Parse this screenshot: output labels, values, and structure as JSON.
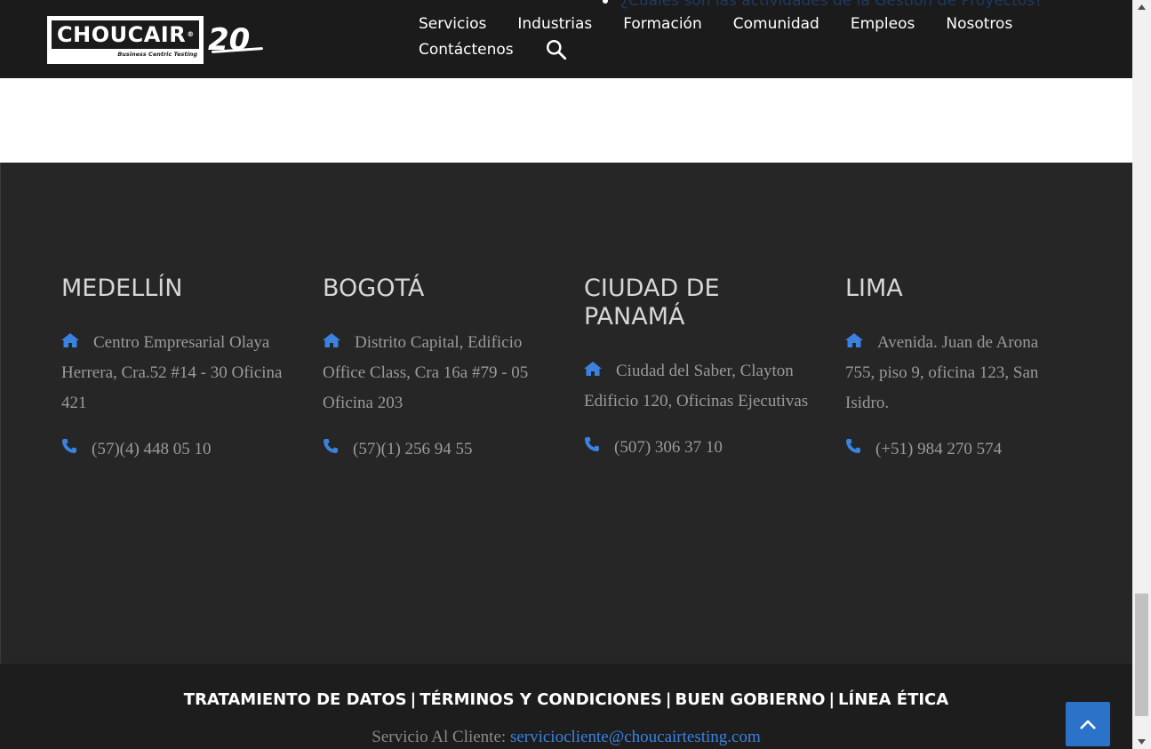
{
  "header": {
    "peek_text": "¿Cuáles son las actividades de la Gestión de Proyectos?",
    "logo": {
      "brand": "CHOUCAIR",
      "tagline": "Business Centric Testing",
      "years": "20"
    },
    "nav": {
      "row1": [
        "Servicios",
        "Industrias",
        "Formación",
        "Comunidad",
        "Empleos",
        "Nosotros"
      ],
      "row2": [
        "Contáctenos"
      ]
    }
  },
  "offices": [
    {
      "city": "MEDELLÍN",
      "address": "Centro Empresarial Olaya Herrera, Cra.52 #14 - 30 Oficina 421",
      "phone": "(57)(4) 448 05 10"
    },
    {
      "city": "BOGOTÁ",
      "address": "Distrito Capital, Edificio Office Class, Cra 16a #79 - 05 Oficina 203",
      "phone": "(57)(1) 256 94 55"
    },
    {
      "city": "CIUDAD DE PANAMÁ",
      "address": "Ciudad del Saber, Clayton Edificio 120, Oficinas Ejecutivas",
      "phone": "(507) 306 37 10"
    },
    {
      "city": "LIMA",
      "address": "Avenida. Juan de Arona 755, piso 9, oficina 123, San Isidro.",
      "phone": "(+51) 984 270 574"
    }
  ],
  "bottom": {
    "links": [
      "TRATAMIENTO DE DATOS",
      "TÉRMINOS Y CONDICIONES",
      "BUEN GOBIERNO",
      "LÍNEA ÉTICA"
    ],
    "separator": "|",
    "service_label": "Servicio Al Cliente:",
    "service_email": "serviciocliente@choucairtesting.com"
  },
  "colors": {
    "accent": "#2a73c9",
    "icon_blue": "#3b82e0",
    "footer_bg": "#262626",
    "header_bg": "#1b1b1b"
  },
  "icons": {
    "home": "home-icon",
    "phone": "phone-icon",
    "search": "search-icon",
    "to_top": "chevron-up-icon"
  }
}
